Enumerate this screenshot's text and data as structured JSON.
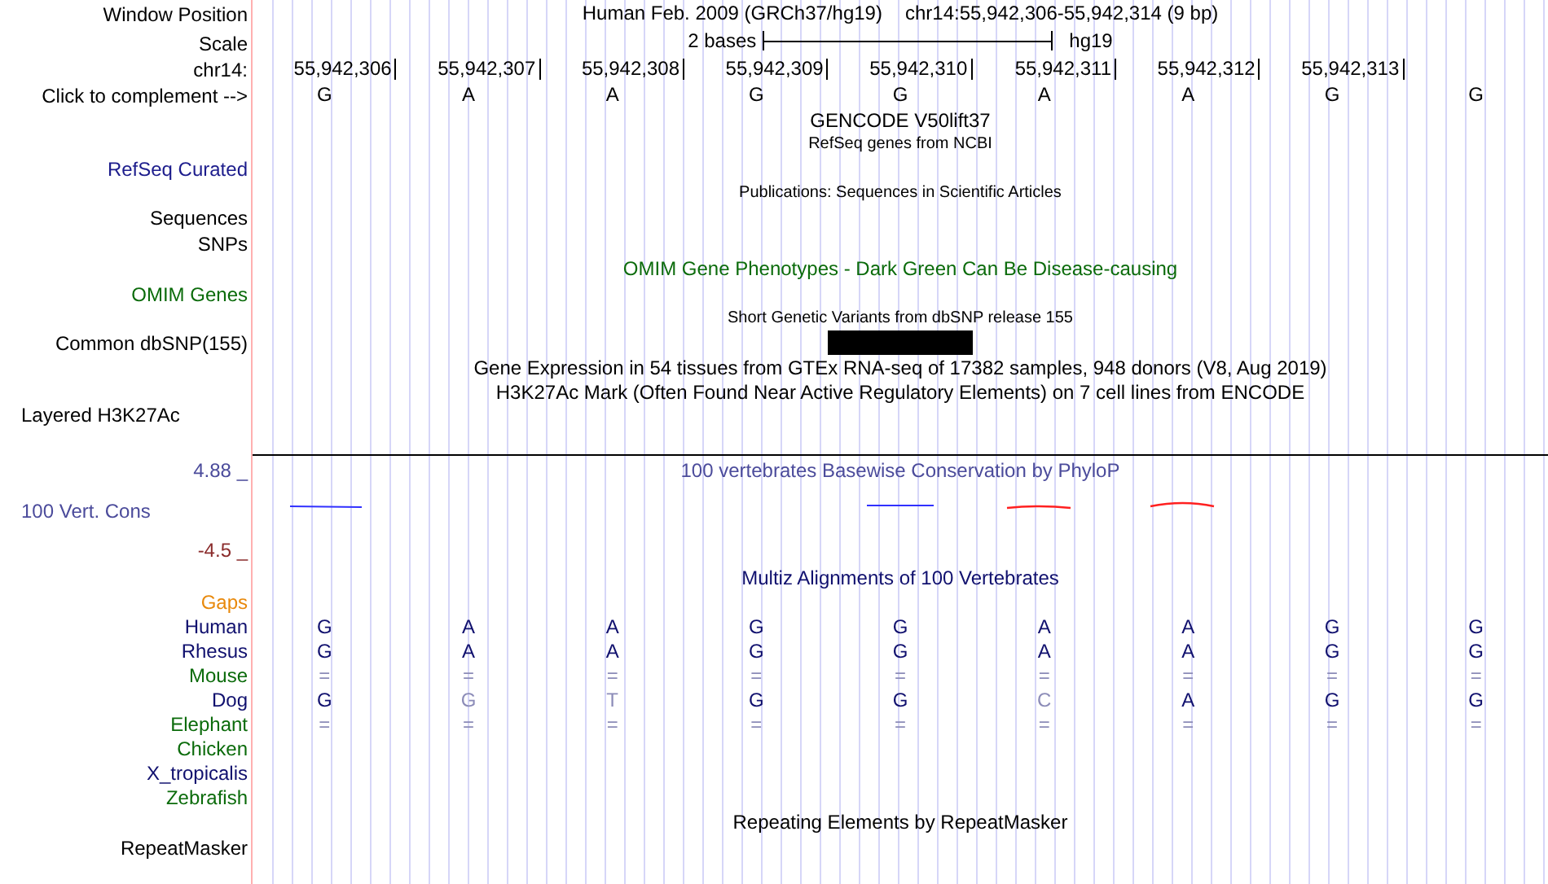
{
  "header": {
    "window_label": "Window Position",
    "assembly": "Human Feb. 2009 (GRCh37/hg19)",
    "location": "chr14:55,942,306-55,942,314 (9 bp)",
    "scale_label": "Scale",
    "scale_text": "2 bases",
    "scale_assembly": "hg19",
    "chrom_label": "chr14:",
    "positions": [
      "55,942,306",
      "55,942,307",
      "55,942,308",
      "55,942,309",
      "55,942,310",
      "55,942,311",
      "55,942,312",
      "55,942,313"
    ],
    "complement_label": "Click to complement -->",
    "bases": [
      "G",
      "A",
      "A",
      "G",
      "G",
      "A",
      "A",
      "G",
      "G"
    ]
  },
  "tracks": [
    {
      "kind": "title",
      "text": "GENCODE V50lift37",
      "color": "#000000"
    },
    {
      "kind": "caption",
      "text": "RefSeq genes from NCBI",
      "color": "#000000"
    },
    {
      "kind": "label",
      "label": "RefSeq Curated",
      "color": "#1c1c8c"
    },
    {
      "kind": "caption",
      "text": "Publications: Sequences in Scientific Articles",
      "color": "#000000"
    },
    {
      "kind": "label",
      "label": "Sequences",
      "color": "#000000"
    },
    {
      "kind": "label",
      "label": "SNPs",
      "color": "#000000"
    },
    {
      "kind": "title",
      "text": "OMIM Gene Phenotypes - Dark Green Can Be Disease-causing",
      "color": "#0b6b0b"
    },
    {
      "kind": "label",
      "label": "OMIM Genes",
      "color": "#0b6b0b"
    },
    {
      "kind": "caption",
      "text": "Short Genetic Variants from dbSNP release 155",
      "color": "#000000"
    },
    {
      "kind": "variants",
      "label": "Common dbSNP(155)",
      "color": "#000000",
      "sites": [
        {
          "variant": false
        },
        {
          "variant": false
        },
        {
          "variant": false
        },
        {
          "variant": false
        },
        {
          "variant": true
        },
        {
          "variant": false
        },
        {
          "variant": false
        },
        {
          "variant": false
        },
        {
          "variant": false
        }
      ]
    },
    {
      "kind": "title",
      "text": "Gene Expression in 54 tissues from GTEx RNA-seq of 17382 samples, 948 donors (V8, Aug 2019)",
      "color": "#000000"
    },
    {
      "kind": "title",
      "text": "H3K27Ac Mark (Often Found Near Active Regulatory Elements) on 7 cell lines from ENCODE",
      "color": "#000000"
    },
    {
      "kind": "composite",
      "label": "Layered H3K27Ac",
      "color": "#000000"
    },
    {
      "kind": "conservation",
      "title": "100 vertebrates Basewise Conservation by PhyloP",
      "label": "100 Vert. Cons",
      "max": "4.88 _",
      "min": "-4.5 _",
      "color": "#4b4b9b"
    },
    {
      "kind": "title",
      "text": "Multiz Alignments of 100 Vertebrates",
      "color": "#10106e"
    },
    {
      "kind": "species",
      "label": "Gaps",
      "color": "#e8890c"
    },
    {
      "kind": "species",
      "label": "Human",
      "color": "#10106e",
      "bases": [
        {
          "text": "G",
          "faded": false
        },
        {
          "text": "A",
          "faded": false
        },
        {
          "text": "A",
          "faded": false
        },
        {
          "text": "G",
          "faded": false
        },
        {
          "text": "G",
          "faded": false
        },
        {
          "text": "A",
          "faded": false
        },
        {
          "text": "A",
          "faded": false
        },
        {
          "text": "G",
          "faded": false
        },
        {
          "text": "G",
          "faded": false
        }
      ]
    },
    {
      "kind": "species",
      "label": "Rhesus",
      "color": "#10106e",
      "bases": [
        {
          "text": "G",
          "faded": false
        },
        {
          "text": "A",
          "faded": false
        },
        {
          "text": "A",
          "faded": false
        },
        {
          "text": "G",
          "faded": false
        },
        {
          "text": "G",
          "faded": false
        },
        {
          "text": "A",
          "faded": false
        },
        {
          "text": "A",
          "faded": false
        },
        {
          "text": "G",
          "faded": false
        },
        {
          "text": "G",
          "faded": false
        }
      ]
    },
    {
      "kind": "species",
      "label": "Mouse",
      "color": "#0b6b0b",
      "bases": [
        {
          "text": "=",
          "faded": true
        },
        {
          "text": "=",
          "faded": true
        },
        {
          "text": "=",
          "faded": true
        },
        {
          "text": "=",
          "faded": true
        },
        {
          "text": "=",
          "faded": true
        },
        {
          "text": "=",
          "faded": true
        },
        {
          "text": "=",
          "faded": true
        },
        {
          "text": "=",
          "faded": true
        },
        {
          "text": "=",
          "faded": true
        }
      ]
    },
    {
      "kind": "species",
      "label": "Dog",
      "color": "#10106e",
      "bases": [
        {
          "text": "G",
          "faded": false
        },
        {
          "text": "G",
          "faded": true
        },
        {
          "text": "T",
          "faded": true
        },
        {
          "text": "G",
          "faded": false
        },
        {
          "text": "G",
          "faded": false
        },
        {
          "text": "C",
          "faded": true
        },
        {
          "text": "A",
          "faded": false
        },
        {
          "text": "G",
          "faded": false
        },
        {
          "text": "G",
          "faded": false
        }
      ]
    },
    {
      "kind": "species",
      "label": "Elephant",
      "color": "#0b6b0b",
      "bases": [
        {
          "text": "=",
          "faded": true
        },
        {
          "text": "=",
          "faded": true
        },
        {
          "text": "=",
          "faded": true
        },
        {
          "text": "=",
          "faded": true
        },
        {
          "text": "=",
          "faded": true
        },
        {
          "text": "=",
          "faded": true
        },
        {
          "text": "=",
          "faded": true
        },
        {
          "text": "=",
          "faded": true
        },
        {
          "text": "=",
          "faded": true
        }
      ]
    },
    {
      "kind": "species",
      "label": "Chicken",
      "color": "#0b6b0b"
    },
    {
      "kind": "species",
      "label": "X_tropicalis",
      "color": "#10106e"
    },
    {
      "kind": "species",
      "label": "Zebrafish",
      "color": "#0b6b0b"
    },
    {
      "kind": "title",
      "text": "Repeating Elements by RepeatMasker",
      "color": "#000000"
    },
    {
      "kind": "label",
      "label": "RepeatMasker",
      "color": "#000000"
    }
  ]
}
